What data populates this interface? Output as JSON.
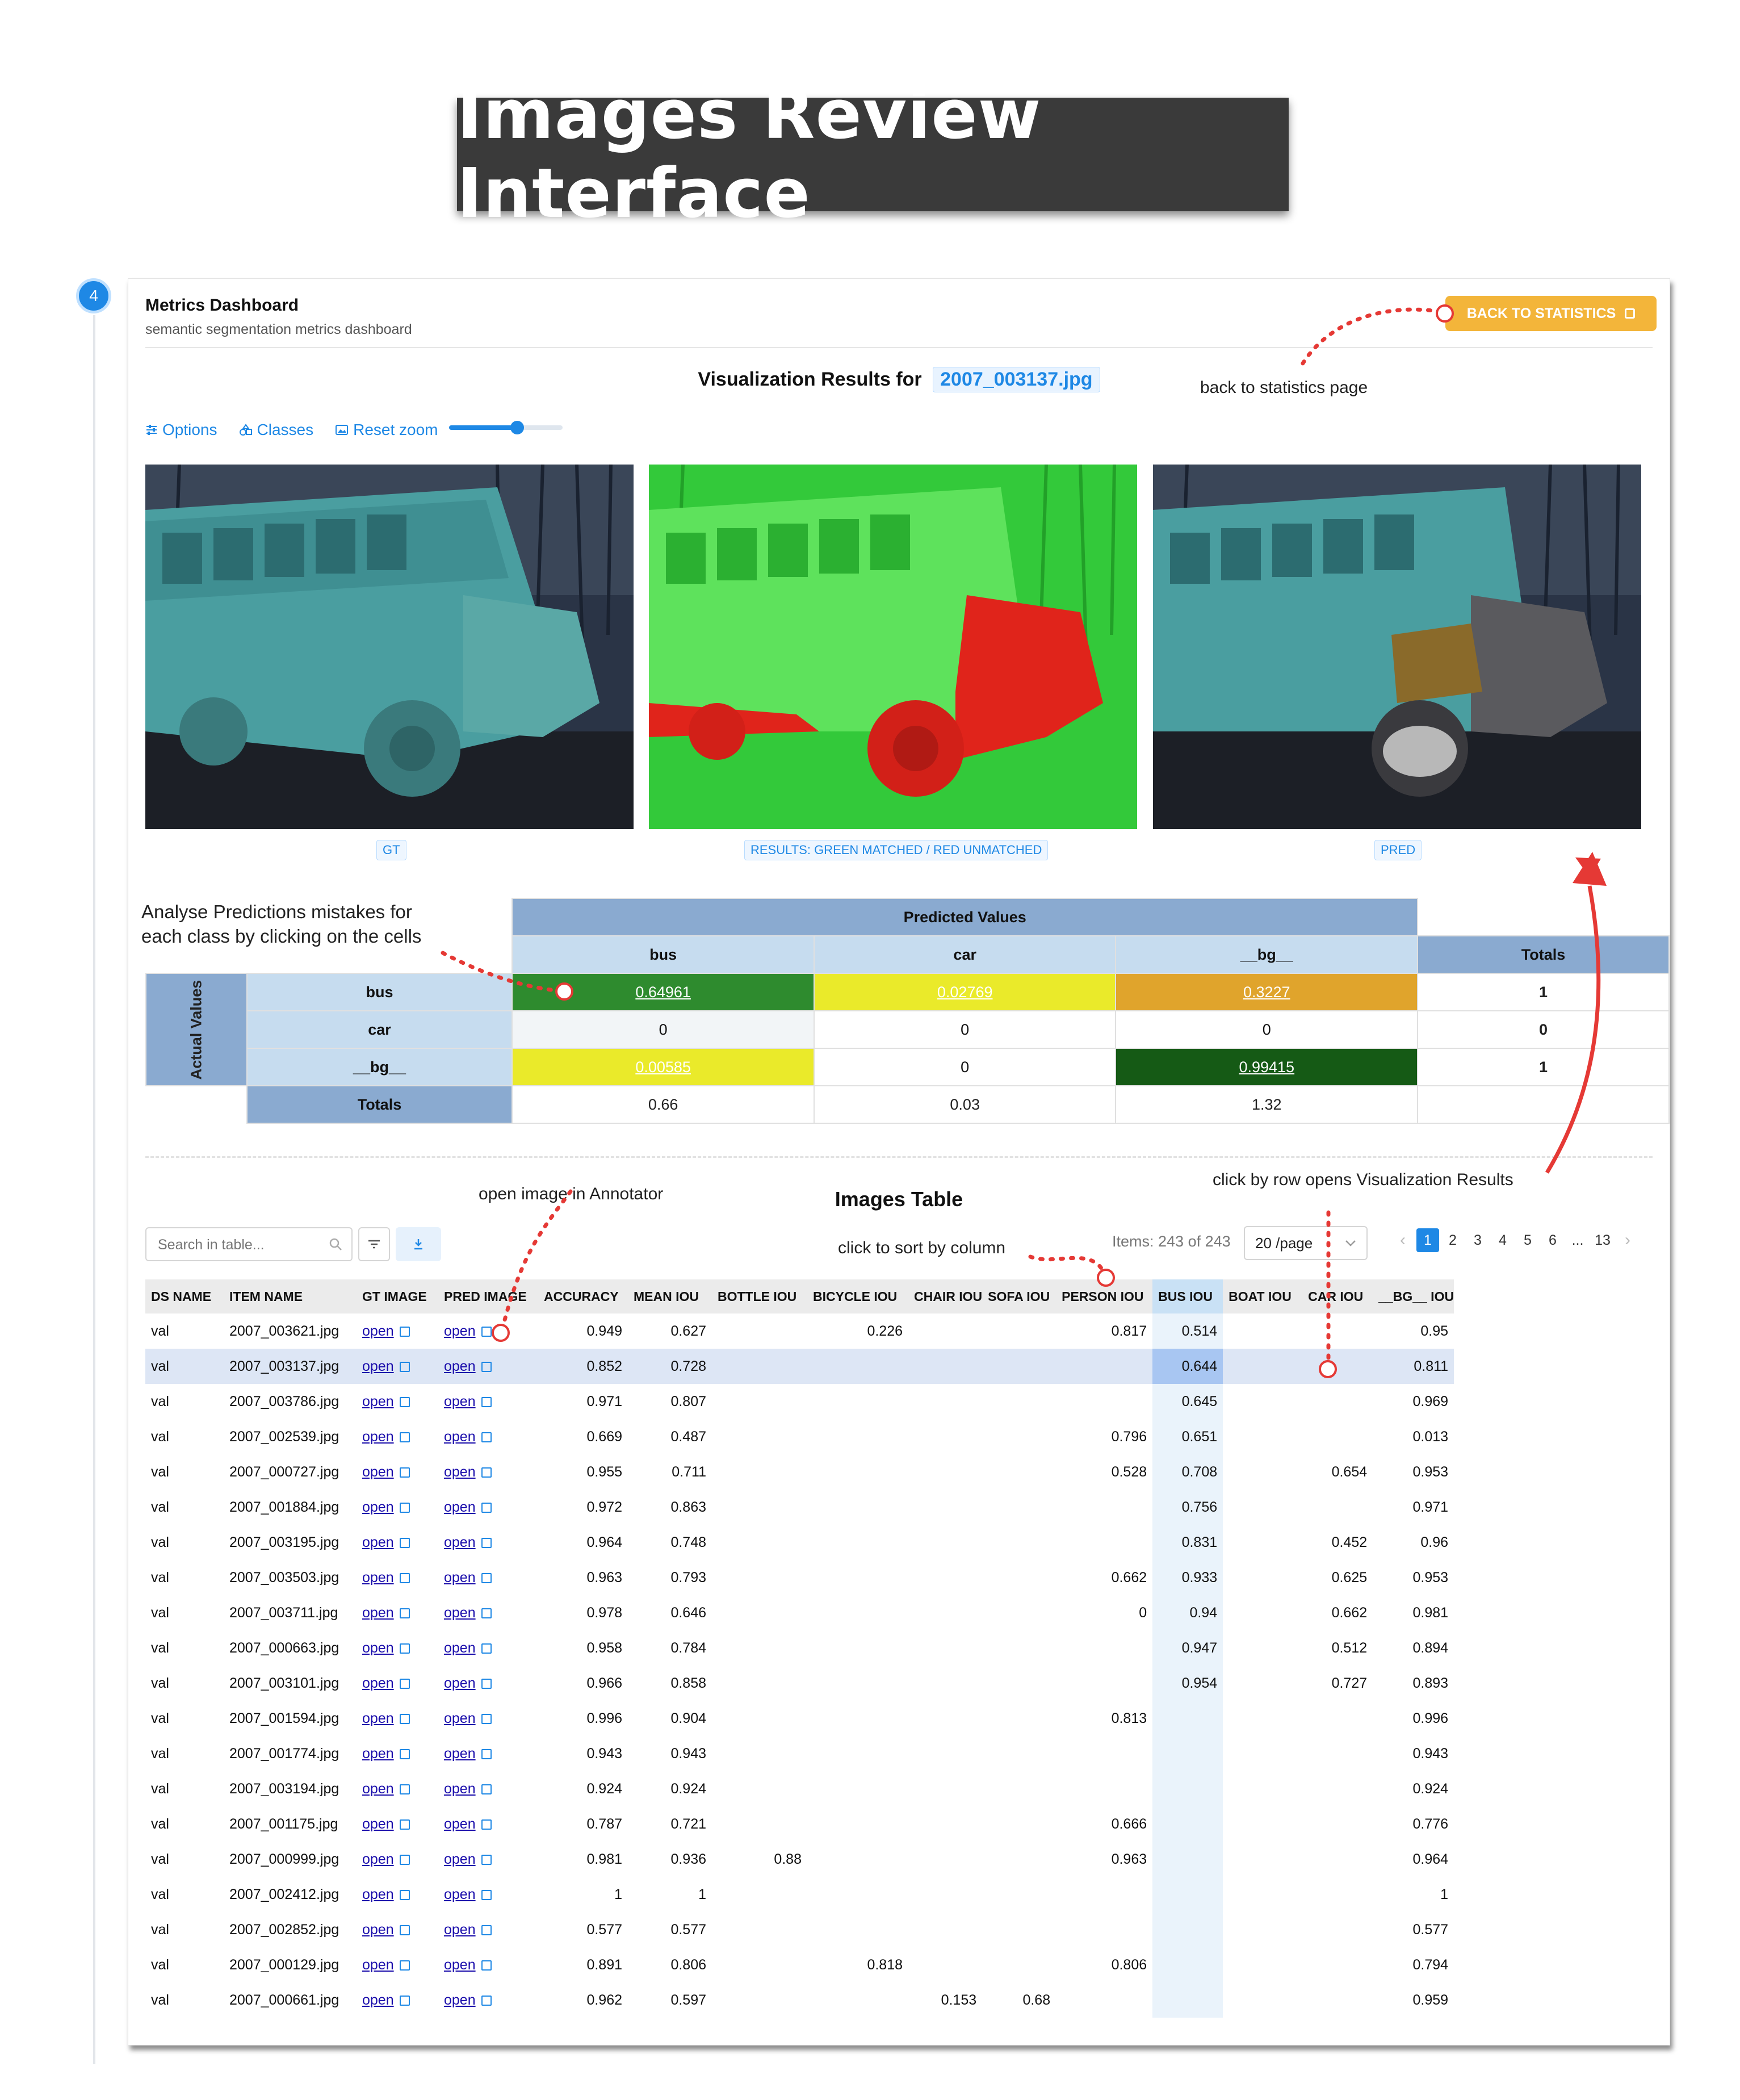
{
  "page_title": "Images Review Interface",
  "step_number": "4",
  "header": {
    "title": "Metrics Dashboard",
    "subtitle": "semantic segmentation metrics dashboard",
    "back_button_label": "BACK TO STATISTICS"
  },
  "visualization": {
    "title_prefix": "Visualization Results for",
    "file_name": "2007_003137.jpg",
    "toolbar": {
      "options": "Options",
      "classes": "Classes",
      "reset_zoom": "Reset zoom"
    },
    "zoom_level": 0.6,
    "captions": {
      "gt": "GT",
      "results": "RESULTS: GREEN MATCHED / RED UNMATCHED",
      "pred": "PRED"
    }
  },
  "annotations": {
    "back_to_statistics": "back to statistics page",
    "analyse_line1": "Analyse Predictions mistakes for",
    "analyse_line2": "each class by clicking on the cells",
    "open_in_annotator": "open image in Annotator",
    "sort_by_column": "click to sort by column",
    "row_opens_results": "click by row opens Visualization Results"
  },
  "confusion_matrix": {
    "predicted_header": "Predicted Values",
    "actual_header": "Actual Values",
    "totals_label": "Totals",
    "classes": [
      "bus",
      "car",
      "__bg__"
    ],
    "rows": [
      {
        "label": "bus",
        "cells": [
          "0.64961",
          "0.02769",
          "0.3227"
        ],
        "total": "1",
        "colors": [
          "#2e8b2e",
          "#eaea2a",
          "#e0a42c"
        ]
      },
      {
        "label": "car",
        "cells": [
          "0",
          "0",
          "0"
        ],
        "total": "0",
        "colors": [
          "#f2f5f7",
          "#ffffff",
          "#ffffff"
        ]
      },
      {
        "label": "__bg__",
        "cells": [
          "0.00585",
          "0",
          "0.99415"
        ],
        "total": "1",
        "colors": [
          "#eaea2a",
          "#ffffff",
          "#155a15"
        ]
      }
    ],
    "column_totals": [
      "0.66",
      "0.03",
      "1.32"
    ]
  },
  "images_table": {
    "title": "Images Table",
    "search_placeholder": "Search in table...",
    "items_text": "Items: 243 of 243",
    "per_page": "20 /page",
    "pages": [
      "1",
      "2",
      "3",
      "4",
      "5",
      "6",
      "...",
      "13"
    ],
    "current_page": "1",
    "selected_row": 1,
    "columns": [
      "DS NAME",
      "ITEM NAME",
      "GT IMAGE",
      "PRED IMAGE",
      "ACCURACY",
      "MEAN IOU",
      "BOTTLE IOU",
      "BICYCLE IOU",
      "CHAIR IOU",
      "SOFA IOU",
      "PERSON IOU",
      "BUS IOU",
      "BOAT IOU",
      "CAR IOU",
      "__BG__ IOU"
    ],
    "link_text": "open",
    "rows": [
      [
        "val",
        "2007_003621.jpg",
        "open",
        "open",
        "0.949",
        "0.627",
        "",
        "0.226",
        "",
        "",
        "0.817",
        "0.514",
        "",
        "",
        "0.95"
      ],
      [
        "val",
        "2007_003137.jpg",
        "open",
        "open",
        "0.852",
        "0.728",
        "",
        "",
        "",
        "",
        "",
        "0.644",
        "",
        "",
        "0.811"
      ],
      [
        "val",
        "2007_003786.jpg",
        "open",
        "open",
        "0.971",
        "0.807",
        "",
        "",
        "",
        "",
        "",
        "0.645",
        "",
        "",
        "0.969"
      ],
      [
        "val",
        "2007_002539.jpg",
        "open",
        "open",
        "0.669",
        "0.487",
        "",
        "",
        "",
        "",
        "0.796",
        "0.651",
        "",
        "",
        "0.013"
      ],
      [
        "val",
        "2007_000727.jpg",
        "open",
        "open",
        "0.955",
        "0.711",
        "",
        "",
        "",
        "",
        "0.528",
        "0.708",
        "",
        "0.654",
        "0.953"
      ],
      [
        "val",
        "2007_001884.jpg",
        "open",
        "open",
        "0.972",
        "0.863",
        "",
        "",
        "",
        "",
        "",
        "0.756",
        "",
        "",
        "0.971"
      ],
      [
        "val",
        "2007_003195.jpg",
        "open",
        "open",
        "0.964",
        "0.748",
        "",
        "",
        "",
        "",
        "",
        "0.831",
        "",
        "0.452",
        "0.96"
      ],
      [
        "val",
        "2007_003503.jpg",
        "open",
        "open",
        "0.963",
        "0.793",
        "",
        "",
        "",
        "",
        "0.662",
        "0.933",
        "",
        "0.625",
        "0.953"
      ],
      [
        "val",
        "2007_003711.jpg",
        "open",
        "open",
        "0.978",
        "0.646",
        "",
        "",
        "",
        "",
        "0",
        "0.94",
        "",
        "0.662",
        "0.981"
      ],
      [
        "val",
        "2007_000663.jpg",
        "open",
        "open",
        "0.958",
        "0.784",
        "",
        "",
        "",
        "",
        "",
        "0.947",
        "",
        "0.512",
        "0.894"
      ],
      [
        "val",
        "2007_003101.jpg",
        "open",
        "open",
        "0.966",
        "0.858",
        "",
        "",
        "",
        "",
        "",
        "0.954",
        "",
        "0.727",
        "0.893"
      ],
      [
        "val",
        "2007_001594.jpg",
        "open",
        "open",
        "0.996",
        "0.904",
        "",
        "",
        "",
        "",
        "0.813",
        "",
        "",
        "",
        "0.996"
      ],
      [
        "val",
        "2007_001774.jpg",
        "open",
        "open",
        "0.943",
        "0.943",
        "",
        "",
        "",
        "",
        "",
        "",
        "",
        "",
        "0.943"
      ],
      [
        "val",
        "2007_003194.jpg",
        "open",
        "open",
        "0.924",
        "0.924",
        "",
        "",
        "",
        "",
        "",
        "",
        "",
        "",
        "0.924"
      ],
      [
        "val",
        "2007_001175.jpg",
        "open",
        "open",
        "0.787",
        "0.721",
        "",
        "",
        "",
        "",
        "0.666",
        "",
        "",
        "",
        "0.776"
      ],
      [
        "val",
        "2007_000999.jpg",
        "open",
        "open",
        "0.981",
        "0.936",
        "0.88",
        "",
        "",
        "",
        "0.963",
        "",
        "",
        "",
        "0.964"
      ],
      [
        "val",
        "2007_002412.jpg",
        "open",
        "open",
        "1",
        "1",
        "",
        "",
        "",
        "",
        "",
        "",
        "",
        "",
        "1"
      ],
      [
        "val",
        "2007_002852.jpg",
        "open",
        "open",
        "0.577",
        "0.577",
        "",
        "",
        "",
        "",
        "",
        "",
        "",
        "",
        "0.577"
      ],
      [
        "val",
        "2007_000129.jpg",
        "open",
        "open",
        "0.891",
        "0.806",
        "",
        "0.818",
        "",
        "",
        "0.806",
        "",
        "",
        "",
        "0.794"
      ],
      [
        "val",
        "2007_000661.jpg",
        "open",
        "open",
        "0.962",
        "0.597",
        "",
        "",
        "0.153",
        "0.68",
        "",
        "",
        "",
        "",
        "0.959"
      ]
    ]
  },
  "colors": {
    "accent": "#1e88e5",
    "warning": "#f3b53a",
    "annotation_red": "#e53935",
    "matched": "#2fd12f",
    "unmatched": "#e0241b"
  }
}
